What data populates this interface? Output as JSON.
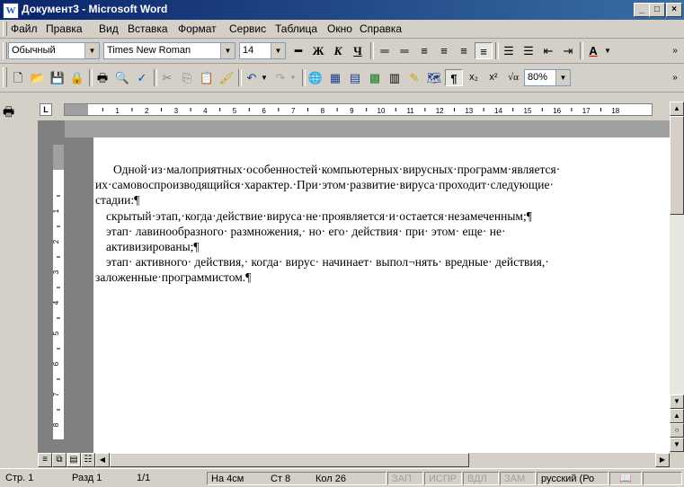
{
  "window": {
    "title": "Документ3 - Microsoft Word",
    "app_icon": "word-icon",
    "buttons": [
      "_",
      "□",
      "×"
    ]
  },
  "menu": [
    "Файл",
    "Правка",
    "Вид",
    "Вставка",
    "Формат",
    "Сервис",
    "Таблица",
    "Окно",
    "Справка"
  ],
  "formatting": {
    "style": "Обычный",
    "font": "Times New Roman",
    "size": "14",
    "buttons": [
      "bold-button",
      "italic-button",
      "underline-button",
      "align-left-button",
      "align-center-button",
      "align-right-button",
      "justify-button",
      "numbering-button",
      "bullets-button",
      "decrease-indent-button",
      "increase-indent-button",
      "font-color-button"
    ],
    "glyphs": {
      "bold": "Ж",
      "italic": "К",
      "underline": "Ч",
      "fontcolor": "А"
    }
  },
  "standard": {
    "zoom": "80%",
    "glyphs": {
      "pilcrow": "¶",
      "sub": "x₂",
      "sup": "x²",
      "eq": "√α"
    }
  },
  "document": {
    "p1_line1": "Одной·из·малоприятных·особенностей·компьютерных·вирусных·программ·является·",
    "p1_line2": "их·самовоспроизводящийся·характер.·При·этом·развитие·вируса·проходит·следующие·",
    "p1_line3": "стадии:¶",
    "p2": "скрытый·этап,·когда·действие·вируса·не·проявляется·и·остается·незамеченным;¶",
    "p3_line1": "этап·  лавинообразного·  размножения,·  но·  его·  действия·  при·  этом·  еще·  не·",
    "p3_line2": "активизированы;¶",
    "p4_line1": "этап·  активного·  действия,·  когда·  вирус·  начинает·  выпол¬нять·  вредные·  действия,·",
    "p4_line2": "заложенные·программистом.¶"
  },
  "ruler": {
    "h_ticks": [
      "1",
      "2",
      "3",
      "4",
      "5",
      "6",
      "7",
      "8",
      "9",
      "10",
      "11",
      "12",
      "13",
      "14",
      "15",
      "16",
      "17",
      "18"
    ],
    "v_ticks": [
      "1",
      "2",
      "3",
      "4",
      "5",
      "6",
      "7",
      "8",
      "9"
    ]
  },
  "status": {
    "page": "Стр. 1",
    "section": "Разд 1",
    "pages": "1/1",
    "at": "На 4см",
    "line": "Ст 8",
    "col": "Кол 26",
    "rec": "ЗАП",
    "trk": "ИСПР",
    "ext": "ВДЛ",
    "ovr": "ЗАМ",
    "lang": "русский (Ро"
  }
}
